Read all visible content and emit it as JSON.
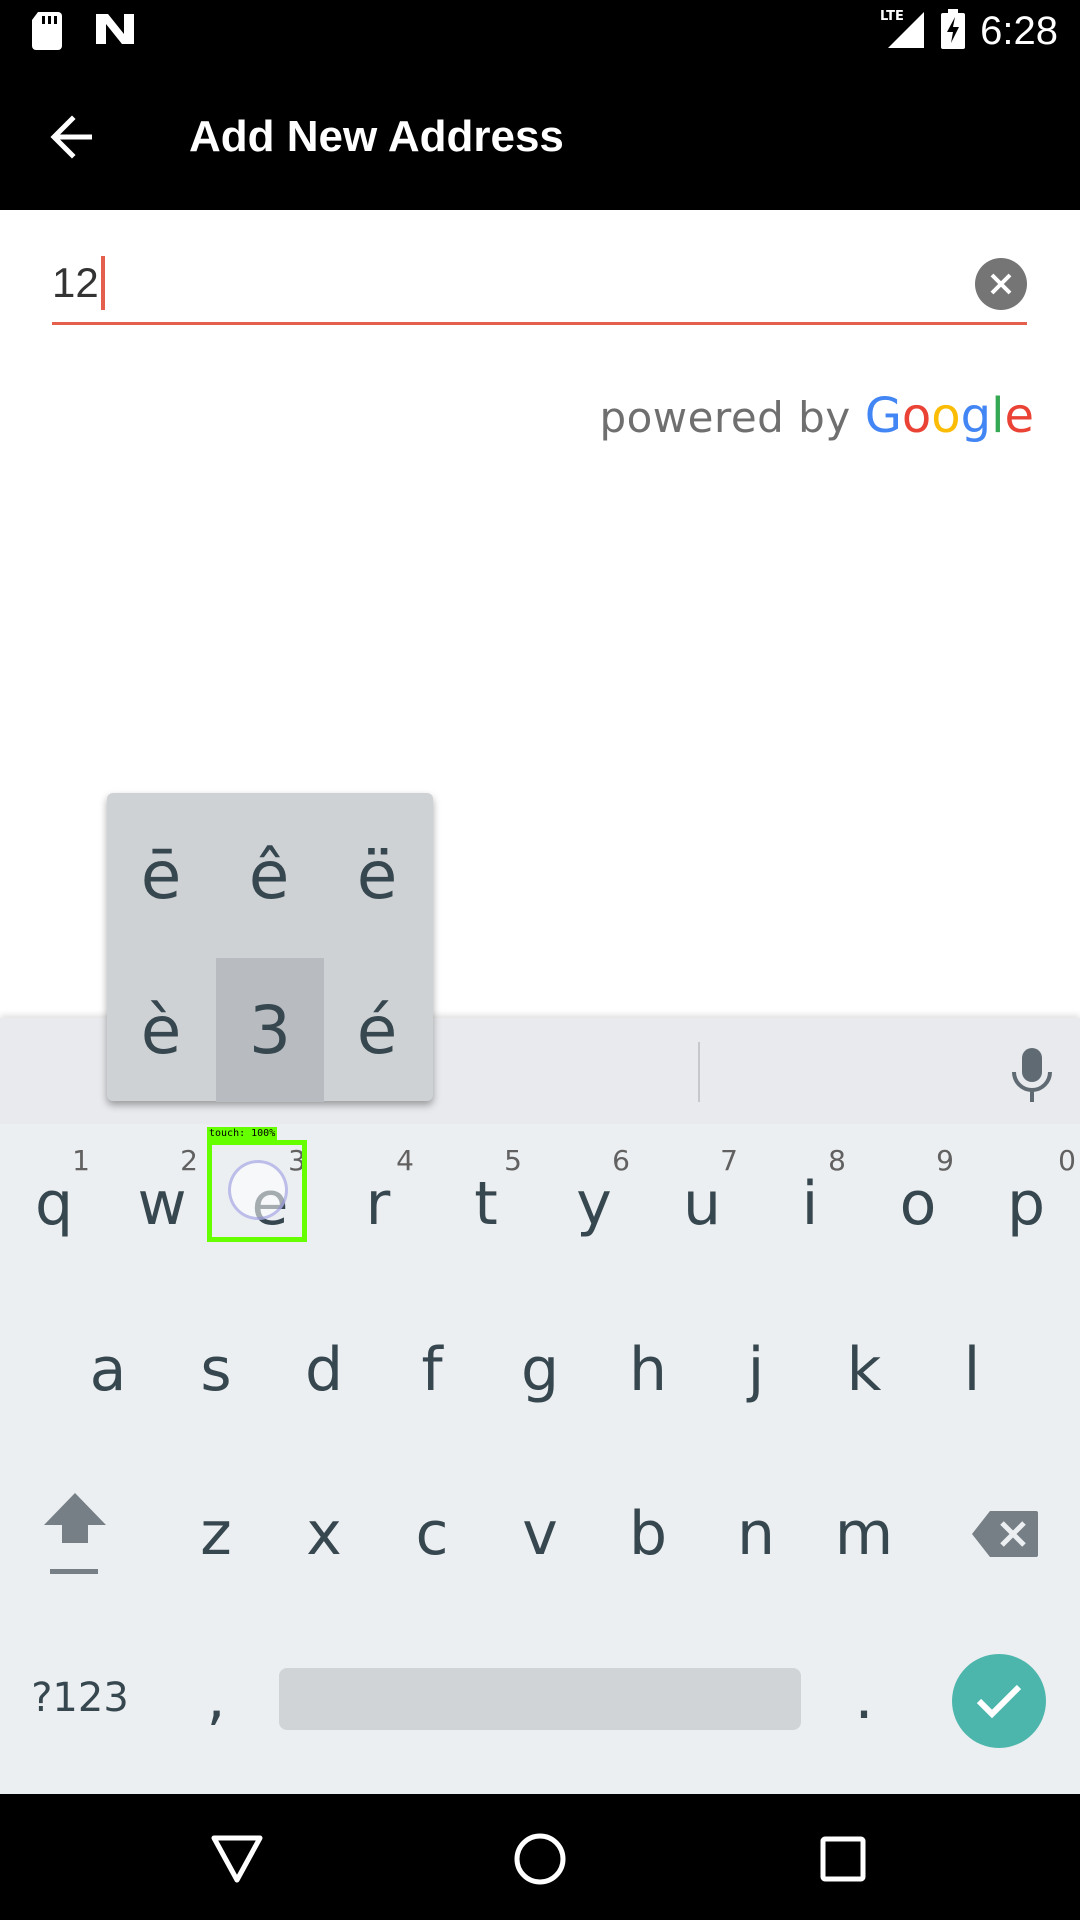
{
  "status_bar": {
    "time": "6:28",
    "network": "LTE",
    "icons": [
      "sd-card-icon",
      "n-icon",
      "signal-icon",
      "battery-charging-icon"
    ]
  },
  "app_bar": {
    "title": "Add New Address",
    "back_icon": "arrow-back-icon"
  },
  "search": {
    "value": "12",
    "clear_icon": "clear-icon",
    "accent_color": "#e4604c"
  },
  "attribution": {
    "text": "powered by",
    "brand": [
      "G",
      "o",
      "o",
      "g",
      "l",
      "e"
    ],
    "brand_colors": [
      "#4285F4",
      "#EA4335",
      "#FBBC05",
      "#4285F4",
      "#34A853",
      "#EA4335"
    ]
  },
  "keyboard": {
    "popup": [
      "ē",
      "ê",
      "ë",
      "è",
      "3",
      "é"
    ],
    "popup_selected": "3",
    "row1": [
      {
        "key": "q",
        "hint": "1"
      },
      {
        "key": "w",
        "hint": "2"
      },
      {
        "key": "e",
        "hint": "3"
      },
      {
        "key": "r",
        "hint": "4"
      },
      {
        "key": "t",
        "hint": "5"
      },
      {
        "key": "y",
        "hint": "6"
      },
      {
        "key": "u",
        "hint": "7"
      },
      {
        "key": "i",
        "hint": "8"
      },
      {
        "key": "o",
        "hint": "9"
      },
      {
        "key": "p",
        "hint": "0"
      }
    ],
    "row2": [
      "a",
      "s",
      "d",
      "f",
      "g",
      "h",
      "j",
      "k",
      "l"
    ],
    "row3": [
      "z",
      "x",
      "c",
      "v",
      "b",
      "n",
      "m"
    ],
    "symbols_label": "?123",
    "comma": ",",
    "period": ".",
    "touch_label": "touch: 100%",
    "enter_color": "#4db6ac"
  },
  "nav_bar": {
    "icons": [
      "back-triangle-icon",
      "home-circle-icon",
      "recents-square-icon"
    ]
  }
}
